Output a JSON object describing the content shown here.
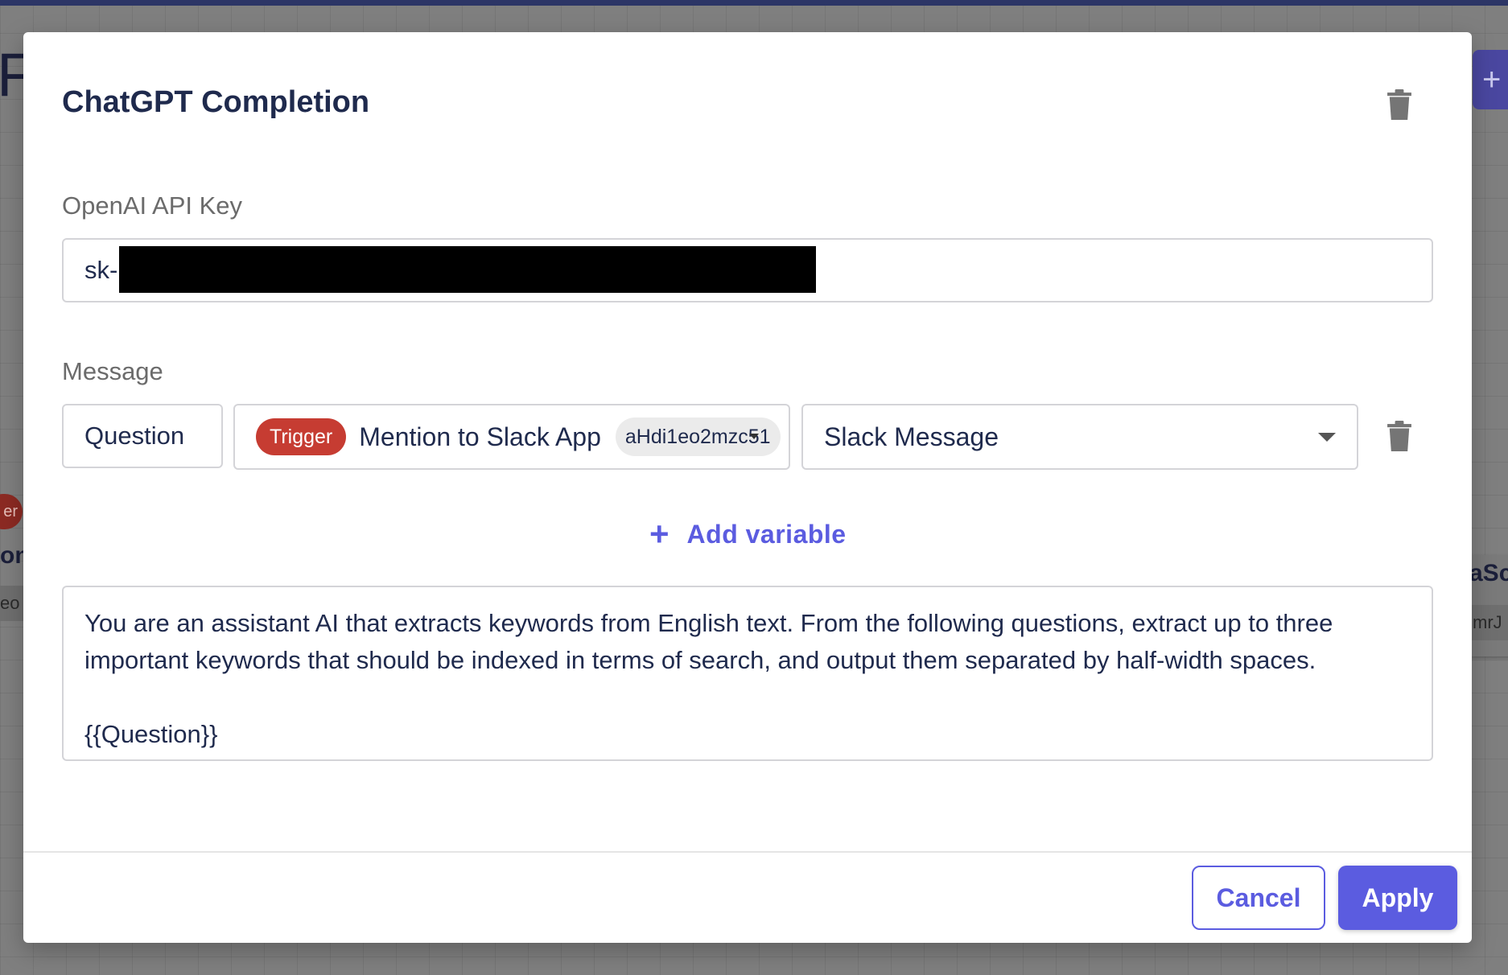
{
  "background": {
    "title_letter": "F",
    "add_icon": "plus-icon",
    "left_badge_text": "er",
    "left_card_text": "on",
    "left_chip_text": "eo",
    "right_card_text": "aSc",
    "right_chip_text": "mrJ"
  },
  "modal": {
    "title": "ChatGPT Completion",
    "delete_icon": "trash-icon",
    "api_key": {
      "label": "OpenAI API Key",
      "value": "sk-"
    },
    "message": {
      "label": "Message",
      "variable": {
        "name": "Question",
        "source_badge": "Trigger",
        "source_name": "Mention to Slack App",
        "source_id": "aHdi1eo2mzc51",
        "field": "Slack Message"
      },
      "add_variable_label": "Add variable",
      "prompt": "You are an assistant AI that extracts keywords from English text. From the following questions, extract up to three important keywords that should be indexed in terms of search, and output them separated by half-width spaces.\n\n{{Question}}"
    },
    "footer": {
      "cancel_label": "Cancel",
      "apply_label": "Apply"
    }
  },
  "colors": {
    "accent": "#5b5ce0",
    "title": "#1f2a4d",
    "trigger_badge": "#c63c32",
    "overlay": "#7f7f7f"
  }
}
